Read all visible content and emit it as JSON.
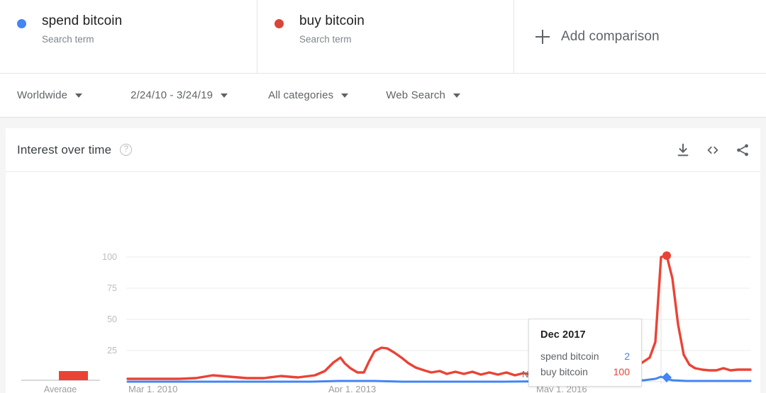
{
  "colors": {
    "series_a": "#4285F4",
    "series_b": "#EA4335",
    "text_primary": "#202124",
    "text_secondary": "#5f6368",
    "grid": "#ebebeb"
  },
  "terms": [
    {
      "label": "spend bitcoin",
      "sublabel": "Search term",
      "color": "#4285F4"
    },
    {
      "label": "buy bitcoin",
      "sublabel": "Search term",
      "color": "#EA4335"
    }
  ],
  "add_comparison": {
    "label": "Add comparison",
    "icon": "plus-icon"
  },
  "filters": [
    {
      "name": "geo",
      "value": "Worldwide"
    },
    {
      "name": "time",
      "value": "2/24/10 - 3/24/19"
    },
    {
      "name": "category",
      "value": "All categories"
    },
    {
      "name": "search_type",
      "value": "Web Search"
    }
  ],
  "card": {
    "title": "Interest over time",
    "help_icon": "?",
    "actions": [
      {
        "name": "download-icon",
        "label": "Download"
      },
      {
        "name": "embed-icon",
        "label": "Embed"
      },
      {
        "name": "share-icon",
        "label": "Share"
      }
    ]
  },
  "average_legend": {
    "label": "Average"
  },
  "chart_note": {
    "label": "Note"
  },
  "tooltip": {
    "date": "Dec 2017",
    "rows": [
      {
        "term": "spend bitcoin",
        "value": "2",
        "color": "#4285F4"
      },
      {
        "term": "buy bitcoin",
        "value": "100",
        "color": "#EA4335"
      }
    ]
  },
  "chart_data": {
    "type": "line",
    "title": "Interest over time",
    "xlabel": "",
    "ylabel": "",
    "ylim": [
      0,
      100
    ],
    "yticks": [
      25,
      50,
      75,
      100
    ],
    "grid": true,
    "legend": "top",
    "xticks": [
      "Mar 1, 2010",
      "Apr 1, 2013",
      "May 1, 2016"
    ],
    "x_range": [
      "2010-02-24",
      "2019-03-24"
    ],
    "highlight": {
      "x": "Dec 2017",
      "series": {
        "spend bitcoin": 2,
        "buy bitcoin": 100
      }
    },
    "x": [
      "2010-03",
      "2010-06",
      "2010-09",
      "2010-12",
      "2011-03",
      "2011-06",
      "2011-09",
      "2011-12",
      "2012-03",
      "2012-06",
      "2012-09",
      "2012-12",
      "2013-03",
      "2013-06",
      "2013-09",
      "2013-12",
      "2014-03",
      "2014-06",
      "2014-09",
      "2014-12",
      "2015-03",
      "2015-06",
      "2015-09",
      "2015-12",
      "2016-03",
      "2016-06",
      "2016-09",
      "2016-12",
      "2017-03",
      "2017-06",
      "2017-09",
      "2017-12",
      "2018-03",
      "2018-06",
      "2018-09",
      "2018-12",
      "2019-03"
    ],
    "series": [
      {
        "name": "spend bitcoin",
        "color": "#4285F4",
        "values": [
          0,
          0,
          0,
          0,
          0,
          1,
          0,
          0,
          0,
          0,
          0,
          0,
          1,
          1,
          0,
          1,
          0,
          0,
          0,
          0,
          0,
          0,
          0,
          0,
          0,
          0,
          0,
          1,
          1,
          1,
          1,
          2,
          1,
          1,
          1,
          1,
          1
        ]
      },
      {
        "name": "buy bitcoin",
        "color": "#EA4335",
        "values": [
          1,
          1,
          1,
          1,
          1,
          3,
          2,
          1,
          1,
          2,
          1,
          2,
          5,
          8,
          4,
          14,
          7,
          6,
          5,
          5,
          4,
          5,
          4,
          5,
          4,
          6,
          4,
          6,
          8,
          12,
          18,
          100,
          22,
          13,
          11,
          12,
          11
        ]
      }
    ]
  }
}
